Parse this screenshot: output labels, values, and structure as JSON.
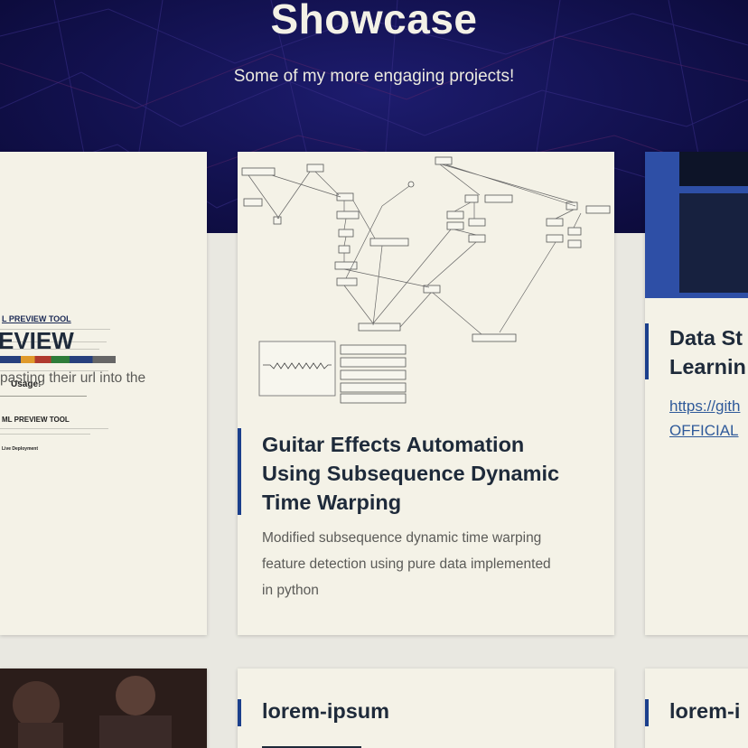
{
  "header": {
    "title": "Showcase",
    "subtitle": "Some of my more engaging projects!"
  },
  "cards": {
    "left": {
      "thumb_title": "L PREVIEW TOOL",
      "thumb_usage": "Usage:",
      "thumb_heading": "ML PREVIEW TOOL",
      "thumb_footer": "Live Deployment",
      "title": "EVIEW",
      "desc": "pasting their url into the"
    },
    "middle": {
      "title_line1": "Guitar Effects Automation",
      "title_line2": "Using Subsequence Dynamic",
      "title_line3": "Time Warping",
      "desc_line1": "Modified subsequence dynamic time warping",
      "desc_line2": "feature detection using pure data implemented",
      "desc_line3": "in python"
    },
    "right": {
      "title_line1": "Data St",
      "title_line2": "Learnin",
      "link_line1": "https://gith",
      "link_line2": "OFFICIAL"
    },
    "bottom_middle": {
      "title": "lorem-ipsum"
    },
    "bottom_right": {
      "title": "lorem-i"
    }
  },
  "colors": {
    "hero_bg": "#12114e",
    "accent": "#1b3f8c",
    "card_bg": "#f4f2e7"
  }
}
